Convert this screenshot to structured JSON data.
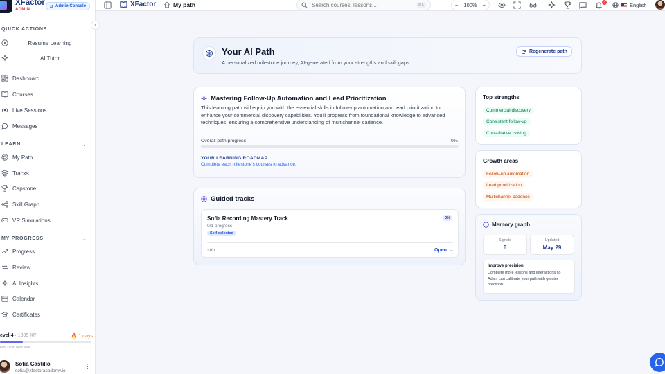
{
  "sidebar": {
    "brand": {
      "name": "XFactor",
      "role": "ADMIN"
    },
    "admin_console": "Admin Console",
    "quick_actions": {
      "label": "QUICK ACTIONS",
      "items": [
        "Resume Learning",
        "AI Tutor"
      ]
    },
    "main_items": [
      "Dashboard",
      "Courses",
      "Live Sessions",
      "Messages"
    ],
    "learn": {
      "label": "LEARN",
      "items": [
        "My Path",
        "Tracks",
        "Capstone",
        "Skill Graph",
        "VR Simulations"
      ]
    },
    "progress_section": {
      "label": "MY PROGRESS",
      "items": [
        "Progress",
        "Review",
        "AI Insights",
        "Calendar",
        "Certificates"
      ]
    },
    "level": {
      "label": "evel 4",
      "xp": "1395 XP",
      "streak": "1 days",
      "next": "605 XP to next level",
      "fraction": 0.25
    },
    "user": {
      "name": "Sofia Castillo",
      "email": "sofia@xfactoracademy.io"
    }
  },
  "topbar": {
    "brand": "XFactor",
    "page": "My path",
    "search_placeholder": "Search courses, lessons...",
    "kbd": "⌘K",
    "zoom": "100%",
    "notifications": "3",
    "language": "English"
  },
  "hero": {
    "title": "Your AI Path",
    "subtitle": "A personalized milestone journey, AI-generated from your strengths and skill gaps.",
    "regenerate": "Regenerate path"
  },
  "path_card": {
    "title": "Mastering Follow-Up Automation and Lead Prioritization",
    "description": "This learning path will equip you with the essential skills in follow-up automation and lead prioritization to enhance your commercial discovery capabilities. You'll progress from foundational knowledge to advanced techniques, ensuring a comprehensive understanding of multichannel cadence.",
    "progress_label": "Overall path progress",
    "progress_pct": "0%",
    "progress_value": 0,
    "roadmap_title": "YOUR LEARNING ROADMAP",
    "roadmap_sub": "Complete each milestone's courses to advance."
  },
  "guided": {
    "title": "Guided tracks",
    "track": {
      "name": "Sofia Recording Mastery Track",
      "pct": "0%",
      "progress": "0/1 progress",
      "badge": "Self-selected",
      "time": "~8h",
      "open": "Open",
      "value": 0
    }
  },
  "strengths": {
    "title": "Top strengths",
    "items": [
      "Commercial discovery",
      "Consistent follow-up",
      "Consultative closing"
    ]
  },
  "growth": {
    "title": "Growth areas",
    "items": [
      "Follow-up automation",
      "Lead prioritization",
      "Multichannel cadence"
    ]
  },
  "memory": {
    "title": "Memory graph",
    "signals_label": "Signals",
    "signals": "6",
    "updated_label": "Updated",
    "updated": "May 29",
    "improve_title": "Improve precision",
    "improve_text": "Complete more lessons and interactions so Adam can calibrate your path with greater precision."
  },
  "colors": {
    "accent": "#6366f1",
    "brand": "#1e3a8a",
    "strength": "#047857",
    "growth": "#c2410c",
    "chat": "#2563eb"
  }
}
